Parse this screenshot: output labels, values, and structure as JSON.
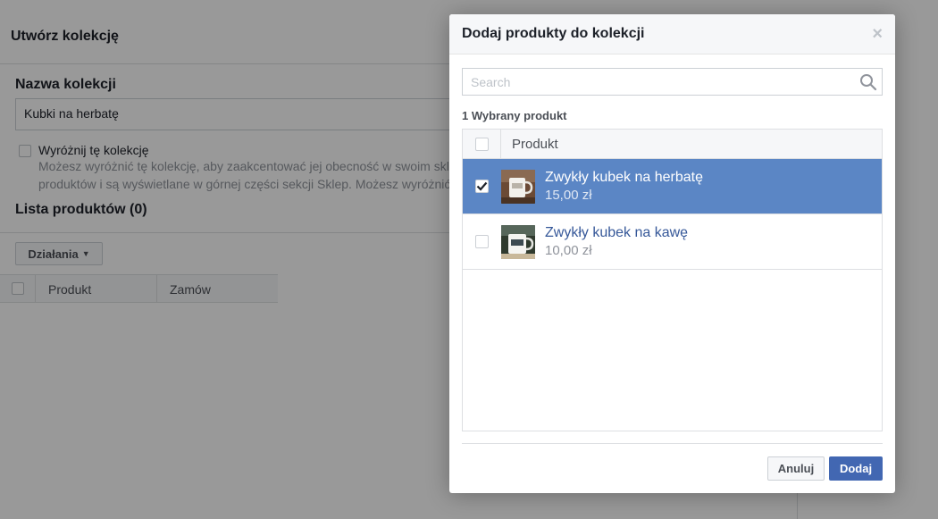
{
  "background": {
    "header_title": "Utwórz kolekcję",
    "name_label": "Nazwa kolekcji",
    "name_value": "Kubki na herbatę",
    "feature_checkbox_label": "Wyróżnij tę kolekcję",
    "feature_desc_line1": "Możesz wyróżnić tę kolekcję, aby zaakcentować jej obecność w swoim skle",
    "feature_desc_line2": "produktów i są wyświetlane w górnej części sekcji Sklep. Możesz wyróżnić",
    "list_title": "Lista produktów (0)",
    "actions_label": "Działania",
    "columns": [
      "Produkt",
      "Zamów"
    ]
  },
  "modal": {
    "title": "Dodaj produkty do kolekcji",
    "close_label": "×",
    "search_placeholder": "Search",
    "selected_count": "1 Wybrany produkt",
    "column_header": "Produkt",
    "products": [
      {
        "name": "Zwykły kubek na herbatę",
        "price": "15,00 zł",
        "selected": true
      },
      {
        "name": "Zwykły kubek na kawę",
        "price": "10,00 zł",
        "selected": false
      }
    ],
    "cancel_label": "Anuluj",
    "add_label": "Dodaj"
  },
  "colors": {
    "selected_row": "#5b86c5",
    "primary_button": "#4267b2",
    "link_text": "#365899"
  }
}
